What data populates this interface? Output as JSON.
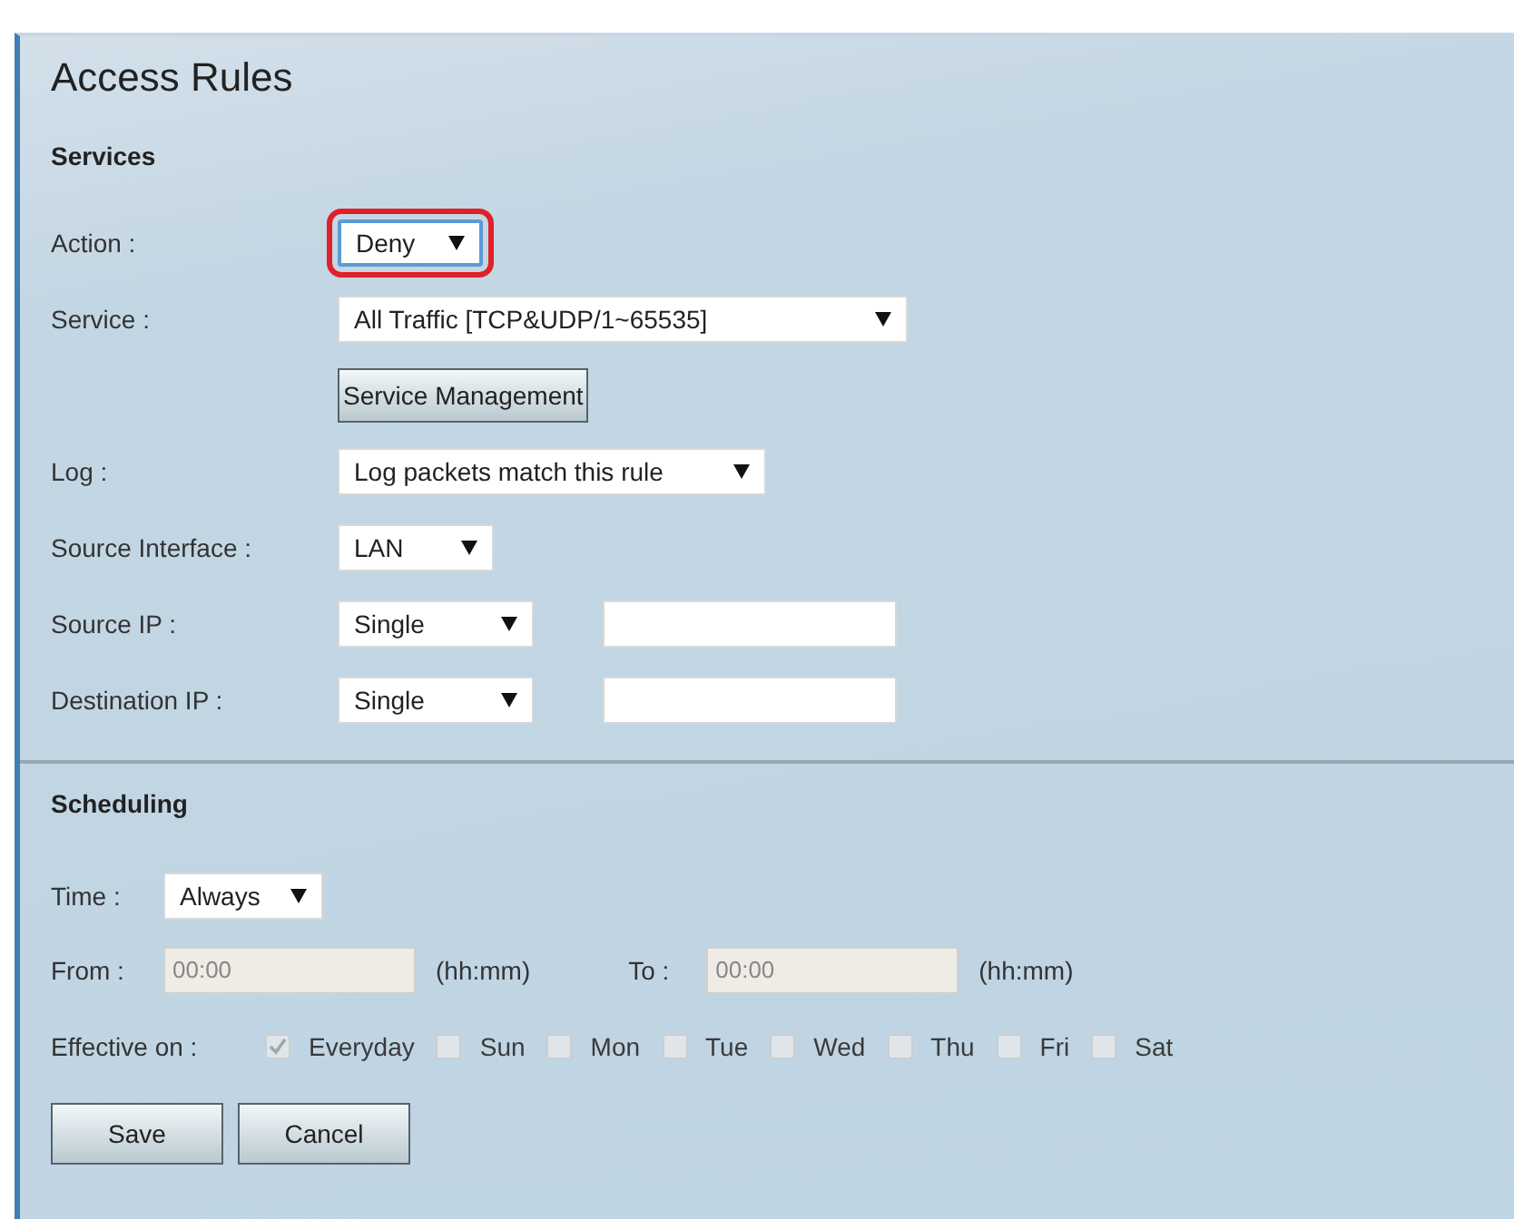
{
  "title": "Access Rules",
  "services": {
    "heading": "Services",
    "rows": [
      {
        "kind": "select",
        "label": "Action :",
        "value": "Deny",
        "highlighted": true
      },
      {
        "kind": "select",
        "label": "Service :",
        "value": "All Traffic [TCP&UDP/1~65535]",
        "highlighted": false
      },
      {
        "kind": "button",
        "label": "Service Management"
      },
      {
        "kind": "select",
        "label": "Log :",
        "value": "Log packets match this rule",
        "highlighted": false
      },
      {
        "kind": "select",
        "label": "Source Interface :",
        "value": "LAN",
        "highlighted": false
      },
      {
        "kind": "select_input",
        "label": "Source IP :",
        "value": "Single",
        "highlighted": false
      },
      {
        "kind": "select_input",
        "label": "Destination IP :",
        "value": "Single",
        "highlighted": false
      }
    ]
  },
  "scheduling": {
    "heading": "Scheduling",
    "time": {
      "label": "Time :",
      "value": "Always"
    },
    "from": {
      "label": "From :",
      "value": "00:00",
      "unit": "(hh:mm)",
      "disabled": true
    },
    "to": {
      "label": "To :",
      "value": "00:00",
      "unit": "(hh:mm)",
      "disabled": true
    },
    "effective_label": "Effective on :",
    "days": [
      {
        "label": "Everyday",
        "checked": true,
        "disabled": true
      },
      {
        "label": "Sun",
        "checked": false,
        "disabled": true
      },
      {
        "label": "Mon",
        "checked": false,
        "disabled": true
      },
      {
        "label": "Tue",
        "checked": false,
        "disabled": true
      },
      {
        "label": "Wed",
        "checked": false,
        "disabled": true
      },
      {
        "label": "Thu",
        "checked": false,
        "disabled": true
      },
      {
        "label": "Fri",
        "checked": false,
        "disabled": true
      },
      {
        "label": "Sat",
        "checked": false,
        "disabled": true
      }
    ]
  },
  "buttons": [
    "Save",
    "Cancel"
  ]
}
